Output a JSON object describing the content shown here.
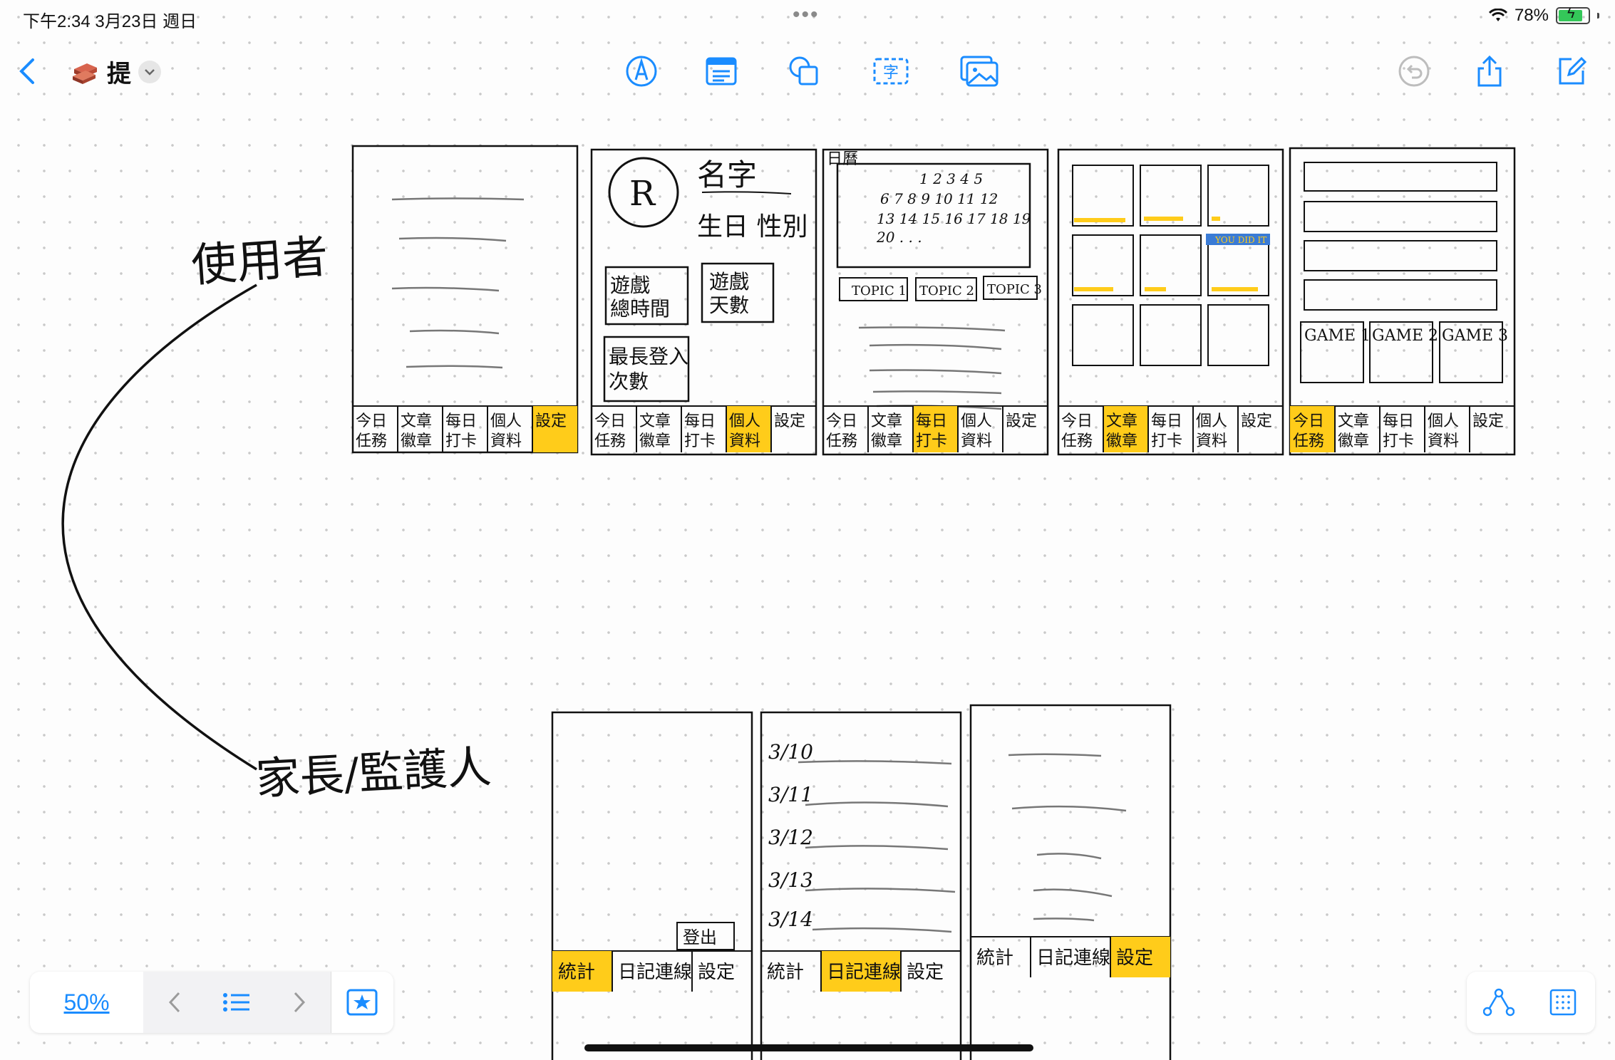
{
  "status_bar": {
    "time": "下午2:34   3月23日 週日",
    "battery": "78%"
  },
  "toolbar": {
    "board_title": "提",
    "board_icon": "brick-stack-icon"
  },
  "sketch": {
    "labels": {
      "user": "使用者",
      "parent": "家長/監護人"
    },
    "user_nav": [
      "今日任務",
      "文章徽章",
      "每日打卡",
      "個人資料",
      "設定"
    ],
    "parent_nav": [
      "統計",
      "日記連線",
      "設定"
    ],
    "profile": {
      "name": "名字",
      "birth_gender": "生日 性別",
      "stat1": "遊戲總時間",
      "stat2": "遊戲天數",
      "stat3": "最長登入次數"
    },
    "calendar": {
      "header": "日曆",
      "rows": [
        "1 2 3 4 5",
        "6 7 8 9 10 11 12",
        "13 14 15 16 17 18 19",
        "20 . . ."
      ]
    },
    "topics": [
      "TOPIC 1",
      "TOPIC 2",
      "TOPIC 3"
    ],
    "badge_note": "YOU DID IT",
    "games": [
      "GAME 1",
      "GAME 2",
      "GAME 3"
    ],
    "dates": [
      "3/10",
      "3/11",
      "3/12",
      "3/13",
      "3/14"
    ],
    "logout": "登出"
  },
  "bottom_bar": {
    "zoom": "50%"
  },
  "colors": {
    "accent": "#1a8cff",
    "highlight": "#ffcc1a"
  }
}
